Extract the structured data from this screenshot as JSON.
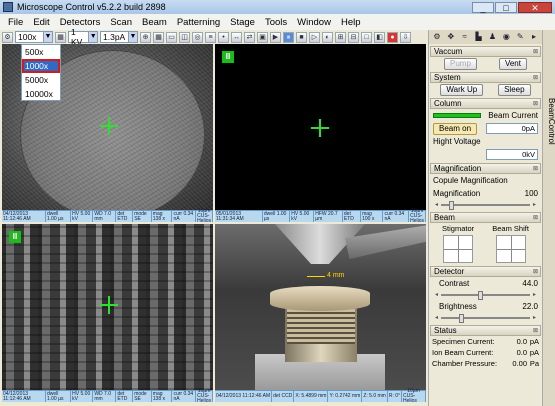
{
  "window": {
    "title": "Microscope Control v5.2.2 build 2898",
    "minimize": "_",
    "maximize": "□",
    "close": "✕"
  },
  "menu": [
    "File",
    "Edit",
    "Detectors",
    "Scan",
    "Beam",
    "Patterning",
    "Stage",
    "Tools",
    "Window",
    "Help"
  ],
  "toolbar": {
    "magnification": "100x",
    "kv": "1 KV",
    "current": "1.3pA"
  },
  "mag_dropdown": {
    "options": [
      "500x",
      "1000x",
      "5000x",
      "10000x"
    ],
    "selected": "1000x"
  },
  "viewports": {
    "quad1": {
      "info": [
        "04/12/2013 11:12:46 AM",
        "dwell 1.00 µs",
        "HV 5.00 kV",
        "WD 7.0 mm",
        "det ETD",
        "mode SE",
        "mag 138 x",
        "curr 0.34 nA"
      ],
      "scale": "10µm",
      "name": "CUS-Helios"
    },
    "quad2": {
      "info": [
        "05/01/2013 11:31:34 AM",
        "dwell 1.00 µs",
        "HV 5.00 kV",
        "HFW 20.7 µm",
        "det ETD",
        "mag 100 x",
        "curr 0.34 nA"
      ],
      "scale": "10µm",
      "name": "CUS-Helios"
    },
    "quad3": {
      "info": [
        "04/12/2013 11:12:46 AM",
        "dwell 1.00 µs",
        "HV 5.00 kV",
        "WD 7.0 mm",
        "det ETD",
        "mode SE",
        "mag 138 x",
        "curr 0.34 nA"
      ],
      "scale": "10µm",
      "name": "CUS-Helios"
    },
    "quad4": {
      "info": [
        "04/12/2013 11:12:46 AM",
        "det CCD",
        "X: 5.4899 mm",
        "Y: 0.2742 mm",
        "Z: 5.0 mm",
        "R: 0°"
      ],
      "scale": "10µm",
      "name": "CUS-Helios",
      "chamber_label": "4 mm"
    }
  },
  "panel": {
    "side_tab": "BeamControl",
    "vacuum": {
      "title": "Vaccum",
      "pump": "Pump",
      "vent": "Vent"
    },
    "system": {
      "title": "System",
      "wakeup": "Wark Up",
      "sleep": "Sleep"
    },
    "column": {
      "title": "Column",
      "beam_current": "Beam Current",
      "beam_on": "Beam on",
      "current_value": "0pA",
      "high_voltage_label": "Hight Voltage",
      "hv_value": "0kV"
    },
    "magnification": {
      "title": "Magnification",
      "couple": "Copule Magnification",
      "label": "Magnification",
      "value": "100"
    },
    "beam": {
      "title": "Beam",
      "stigmator": "Stigmator",
      "shift": "Beam Shift"
    },
    "detector": {
      "title": "Detector",
      "contrast": "Contrast",
      "contrast_value": "44.0",
      "brightness": "Brightness",
      "brightness_value": "22.0"
    },
    "status": {
      "title": "Status",
      "rows": [
        {
          "label": "Specimen Current:",
          "value": "0.0",
          "unit": "pA"
        },
        {
          "label": "Ion Beam Current:",
          "value": "0.0",
          "unit": "pA"
        },
        {
          "label": "Chamber Pressure:",
          "value": "0.00",
          "unit": "Pa"
        }
      ]
    }
  },
  "levels": {
    "magnification_slider": 0.1,
    "contrast_slider": 0.44,
    "brightness_slider": 0.22
  },
  "colors": {
    "crosshair": "#2fe02f",
    "pause": "#28b428",
    "beam_meter": "#1ec11e"
  }
}
